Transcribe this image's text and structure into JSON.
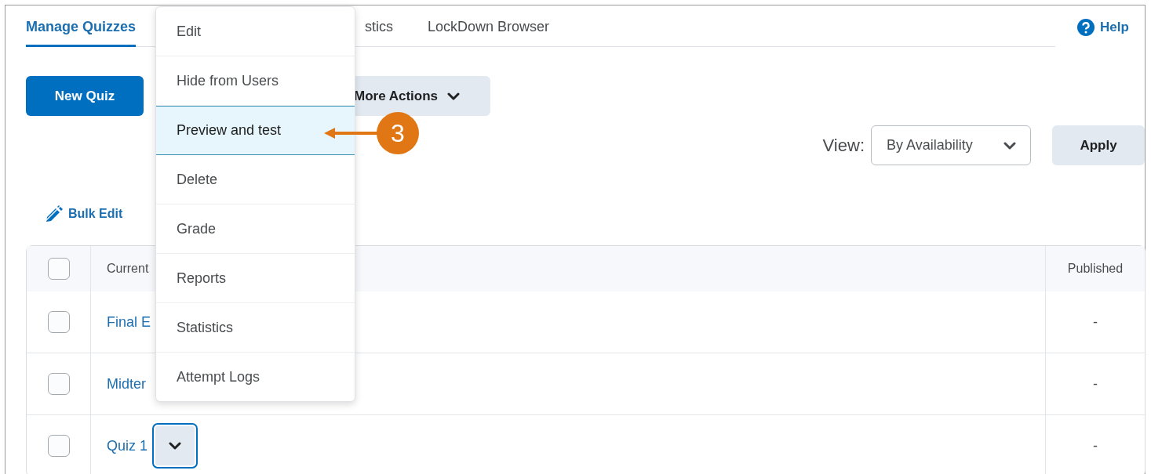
{
  "tabs": [
    {
      "label": "Manage Quizzes",
      "selected": true
    },
    {
      "label": "stics",
      "selected": false
    },
    {
      "label": "LockDown Browser",
      "selected": false
    }
  ],
  "help": "Help",
  "new_quiz_button": "New Quiz",
  "more_actions_button": "More Actions",
  "view": {
    "label": "View:",
    "value": "By Availability"
  },
  "apply_button": "Apply",
  "bulk_edit": "Bulk Edit",
  "table": {
    "select_all_checked": false,
    "columns": [
      "Current",
      "Published"
    ],
    "rows": [
      {
        "name": "Final E",
        "published": "-",
        "checked": false,
        "menu_button": false
      },
      {
        "name": "Midter",
        "published": "-",
        "checked": false,
        "menu_button": false
      },
      {
        "name": "Quiz 1",
        "published": "-",
        "checked": false,
        "menu_button": true
      }
    ]
  },
  "context_menu": {
    "items": [
      {
        "label": "Edit",
        "selected": false
      },
      {
        "label": "Hide from Users",
        "selected": false
      },
      {
        "label": "Preview and test",
        "selected": true
      },
      {
        "label": "Delete",
        "selected": false
      },
      {
        "label": "Grade",
        "selected": false
      },
      {
        "label": "Reports",
        "selected": false
      },
      {
        "label": "Statistics",
        "selected": false
      },
      {
        "label": "Attempt Logs",
        "selected": false
      }
    ]
  },
  "callout": {
    "number": "3"
  }
}
